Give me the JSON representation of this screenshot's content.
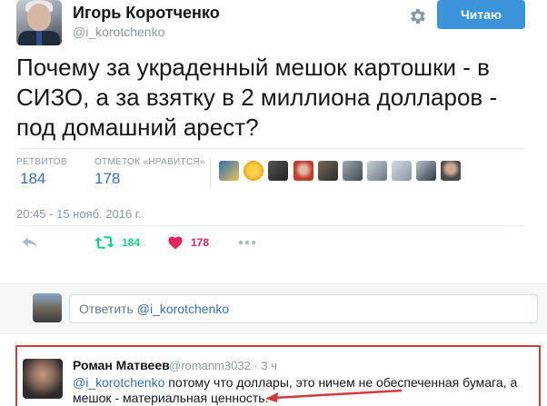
{
  "author": {
    "name": "Игорь Коротченко",
    "handle": "@i_korotchenko"
  },
  "follow_button": {
    "label": "Читаю"
  },
  "tweet": {
    "text": "Почему за украденный мешок картошки - в СИЗО, а за взятку в 2 миллиона долларов - под домашний арест?",
    "timestamp": "20:45 - 15 нояб. 2016 г."
  },
  "stats": {
    "retweets_label": "РЕТВИТОВ",
    "retweets_value": "184",
    "likes_label": "ОТМЕТОК «НРАВИТСЯ»",
    "likes_value": "178"
  },
  "actions": {
    "retweet_count": "184",
    "like_count": "178"
  },
  "reply_box": {
    "prefix": "Ответить ",
    "mention": "@i_korotchenko"
  },
  "reply": {
    "name": "Роман Матвеев",
    "handle": "@romanm3032 · 3 ч",
    "mention": "@i_korotchenko",
    "text": " потому что доллары, это ничем не обеспеченная бумага, а мешок -  материальная ценность."
  },
  "colors": {
    "accent": "#3b94d9",
    "retweet_green": "#19cf86",
    "like_red": "#e0245e",
    "highlight_red": "#d03c3c"
  },
  "icons": [
    "gear-icon",
    "reply-icon",
    "retweet-icon",
    "heart-icon",
    "more-icon",
    "arrow-icon"
  ]
}
